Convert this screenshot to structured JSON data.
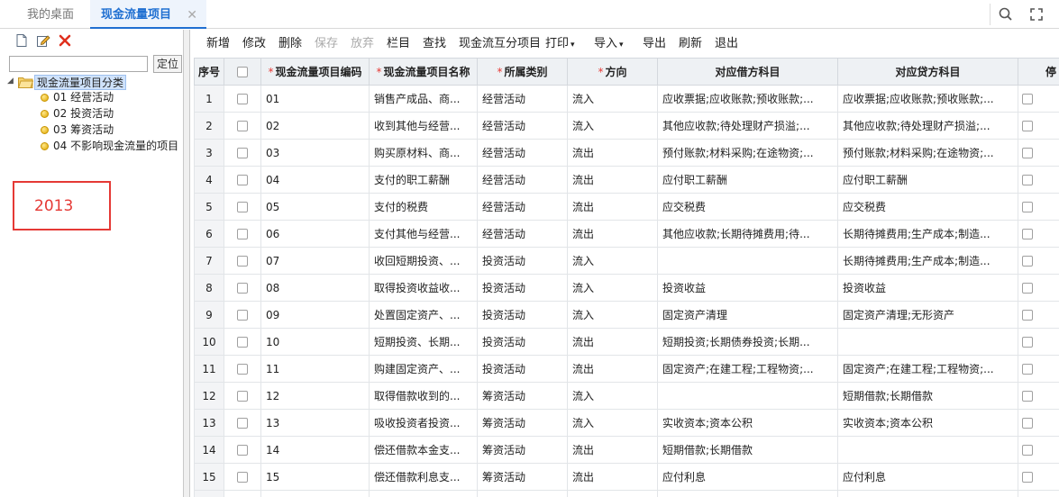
{
  "tabs": {
    "desktop": "我的桌面",
    "active": "现金流量项目",
    "close_glyph": "✕"
  },
  "tree": {
    "locate_button": "定位",
    "search_value": "",
    "root_label": "现金流量项目分类",
    "items": [
      {
        "label": "01 经营活动"
      },
      {
        "label": "02 投资活动"
      },
      {
        "label": "03 筹资活动"
      },
      {
        "label": "04 不影响现金流量的项目"
      }
    ],
    "annotation": "2013"
  },
  "toolbar": {
    "new": "新增",
    "edit": "修改",
    "delete": "删除",
    "save": "保存",
    "discard": "放弃",
    "columns": "栏目",
    "find": "查找",
    "interchange": "现金流互分项目",
    "print": "打印",
    "import": "导入",
    "export": "导出",
    "refresh": "刷新",
    "exit": "退出",
    "caret": "▾"
  },
  "table": {
    "headers": {
      "index": "序号",
      "code": "现金流量项目编码",
      "name": "现金流量项目名称",
      "category": "所属类别",
      "direction": "方向",
      "debit": "对应借方科目",
      "credit": "对应贷方科目",
      "stop": "停"
    },
    "required_mark": "*",
    "rows": [
      {
        "idx": "1",
        "code": "01",
        "name": "销售产成品、商...",
        "category": "经营活动",
        "direction": "流入",
        "debit": "应收票据;应收账款;预收账款;...",
        "credit": "应收票据;应收账款;预收账款;..."
      },
      {
        "idx": "2",
        "code": "02",
        "name": "收到其他与经营...",
        "category": "经营活动",
        "direction": "流入",
        "debit": "其他应收款;待处理财产损溢;...",
        "credit": "其他应收款;待处理财产损溢;..."
      },
      {
        "idx": "3",
        "code": "03",
        "name": "购买原材料、商...",
        "category": "经营活动",
        "direction": "流出",
        "debit": "预付账款;材料采购;在途物资;...",
        "credit": "预付账款;材料采购;在途物资;..."
      },
      {
        "idx": "4",
        "code": "04",
        "name": "支付的职工薪酬",
        "category": "经营活动",
        "direction": "流出",
        "debit": "应付职工薪酬",
        "credit": "应付职工薪酬"
      },
      {
        "idx": "5",
        "code": "05",
        "name": "支付的税费",
        "category": "经营活动",
        "direction": "流出",
        "debit": "应交税费",
        "credit": "应交税费"
      },
      {
        "idx": "6",
        "code": "06",
        "name": "支付其他与经营...",
        "category": "经营活动",
        "direction": "流出",
        "debit": "其他应收款;长期待摊费用;待...",
        "credit": "长期待摊费用;生产成本;制造..."
      },
      {
        "idx": "7",
        "code": "07",
        "name": "收回短期投资、...",
        "category": "投资活动",
        "direction": "流入",
        "debit": "",
        "credit": "长期待摊费用;生产成本;制造..."
      },
      {
        "idx": "8",
        "code": "08",
        "name": "取得投资收益收...",
        "category": "投资活动",
        "direction": "流入",
        "debit": "投资收益",
        "credit": "投资收益"
      },
      {
        "idx": "9",
        "code": "09",
        "name": "处置固定资产、...",
        "category": "投资活动",
        "direction": "流入",
        "debit": "固定资产清理",
        "credit": "固定资产清理;无形资产"
      },
      {
        "idx": "10",
        "code": "10",
        "name": "短期投资、长期...",
        "category": "投资活动",
        "direction": "流出",
        "debit": "短期投资;长期债券投资;长期...",
        "credit": ""
      },
      {
        "idx": "11",
        "code": "11",
        "name": "购建固定资产、...",
        "category": "投资活动",
        "direction": "流出",
        "debit": "固定资产;在建工程;工程物资;...",
        "credit": "固定资产;在建工程;工程物资;..."
      },
      {
        "idx": "12",
        "code": "12",
        "name": "取得借款收到的...",
        "category": "筹资活动",
        "direction": "流入",
        "debit": "",
        "credit": "短期借款;长期借款"
      },
      {
        "idx": "13",
        "code": "13",
        "name": "吸收投资者投资...",
        "category": "筹资活动",
        "direction": "流入",
        "debit": "实收资本;资本公积",
        "credit": "实收资本;资本公积"
      },
      {
        "idx": "14",
        "code": "14",
        "name": "偿还借款本金支...",
        "category": "筹资活动",
        "direction": "流出",
        "debit": "短期借款;长期借款",
        "credit": ""
      },
      {
        "idx": "15",
        "code": "15",
        "name": "偿还借款利息支...",
        "category": "筹资活动",
        "direction": "流出",
        "debit": "应付利息",
        "credit": "应付利息"
      }
    ]
  },
  "colors": {
    "accent": "#1f6fd1",
    "annotation": "#e53935",
    "header_bg": "#eef1f4"
  }
}
